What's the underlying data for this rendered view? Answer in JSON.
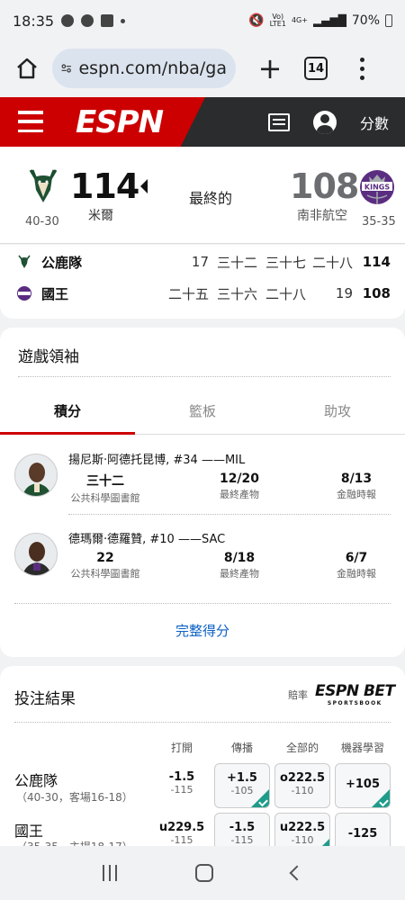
{
  "status_bar": {
    "time": "18:35",
    "net_top": "Vo)",
    "net_bottom": "LTE1",
    "lte": "4G+",
    "battery": "70%"
  },
  "browser": {
    "url": "espn.com/nba/ga",
    "tab_count": "14"
  },
  "header": {
    "logo": "ESPN",
    "scores_link": "分數"
  },
  "game": {
    "home": {
      "name": "米爾",
      "score": "114",
      "record": "40-30"
    },
    "away": {
      "name": "南非航空",
      "score": "108",
      "record": "35-35"
    },
    "status": "最終的"
  },
  "linescore": [
    {
      "team": "公鹿隊",
      "q": [
        "17",
        "三十二",
        "三十七",
        "二十八"
      ],
      "total": "114"
    },
    {
      "team": "國王",
      "q": [
        "二十五",
        "三十六",
        "二十八",
        "19"
      ],
      "total": "108"
    }
  ],
  "leaders": {
    "title": "遊戲領袖",
    "tabs": [
      "積分",
      "籃板",
      "助攻"
    ],
    "players": [
      {
        "name": "揚尼斯·阿德托昆博, #34 ——MIL",
        "stats": [
          {
            "value": "三十二",
            "label": "公共科學圖書館"
          },
          {
            "value": "12/20",
            "label": "最終產物"
          },
          {
            "value": "8/13",
            "label": "金融時報"
          }
        ]
      },
      {
        "name": "德瑪爾·德羅贊, #10 ——SAC",
        "stats": [
          {
            "value": "22",
            "label": "公共科學圖書館"
          },
          {
            "value": "8/18",
            "label": "最終產物"
          },
          {
            "value": "6/7",
            "label": "金融時報"
          }
        ]
      }
    ],
    "full_box": "完整得分"
  },
  "betting": {
    "title": "投注結果",
    "odds_label": "賠率",
    "brand": "ESPN BET",
    "brand_sub": "SPORTSBOOK",
    "columns": [
      "打開",
      "傳播",
      "全部的",
      "機器學習"
    ],
    "rows": [
      {
        "team": "公鹿隊",
        "record": "（40-30，客場16-18）",
        "open": [
          "-1.5",
          "-115"
        ],
        "spread": [
          "+1.5",
          "-105"
        ],
        "total": [
          "o222.5",
          "-110"
        ],
        "ml": "+105"
      },
      {
        "team": "國王",
        "record": "（35-35，主場18-17）",
        "open": [
          "u229.5",
          "-115"
        ],
        "spread": [
          "-1.5",
          "-115"
        ],
        "total": [
          "u222.5",
          "-110"
        ],
        "ml": "-125"
      }
    ]
  },
  "colors": {
    "espn_red": "#cc0000",
    "header_dark": "#2b2c2d",
    "link_blue": "#0b61c4",
    "win_teal": "#1e9c8a"
  }
}
